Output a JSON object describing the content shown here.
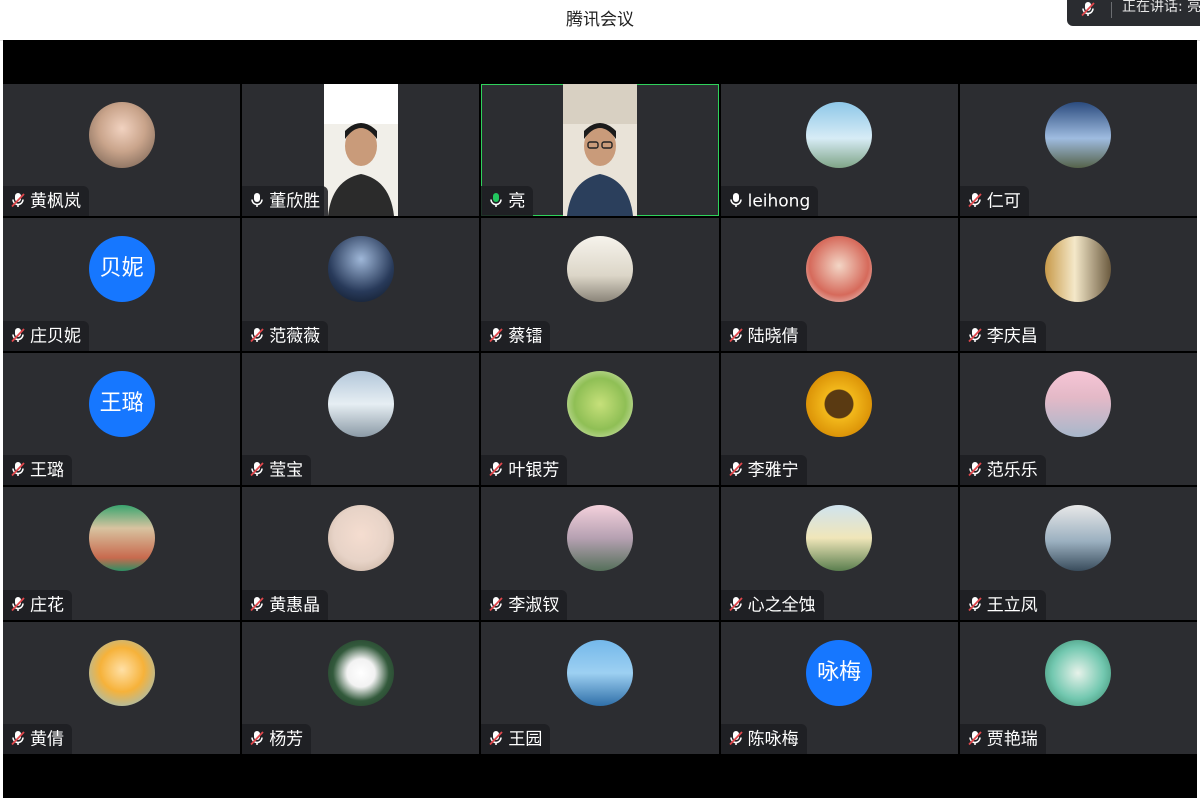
{
  "window": {
    "title": "腾讯会议"
  },
  "speaking_indicator": {
    "label": "正在讲话: 亮",
    "icon": "mic-muted-icon"
  },
  "colors": {
    "tile_bg": "#2c2d31",
    "active_border": "#2fd15b",
    "avatar_blue": "#1677ff",
    "muted_red": "#e0474c"
  },
  "participants": [
    {
      "name": "黄枫岚",
      "mic": "muted",
      "avatar": "photo"
    },
    {
      "name": "董欣胜",
      "mic": "on",
      "avatar": "video"
    },
    {
      "name": "亮",
      "mic": "speaking",
      "avatar": "video",
      "active": true
    },
    {
      "name": "leihong",
      "mic": "on",
      "avatar": "photo"
    },
    {
      "name": "仁可",
      "mic": "muted",
      "avatar": "photo"
    },
    {
      "name": "庄贝妮",
      "mic": "muted",
      "avatar": "text",
      "avatar_text": "贝妮"
    },
    {
      "name": "范薇薇",
      "mic": "muted",
      "avatar": "photo"
    },
    {
      "name": "蔡镭",
      "mic": "muted",
      "avatar": "photo"
    },
    {
      "name": "陆晓倩",
      "mic": "muted",
      "avatar": "photo"
    },
    {
      "name": "李庆昌",
      "mic": "muted",
      "avatar": "photo"
    },
    {
      "name": "王璐",
      "mic": "muted",
      "avatar": "text",
      "avatar_text": "王璐"
    },
    {
      "name": "莹宝",
      "mic": "muted",
      "avatar": "photo"
    },
    {
      "name": "叶银芳",
      "mic": "muted",
      "avatar": "photo"
    },
    {
      "name": "李雅宁",
      "mic": "muted",
      "avatar": "photo"
    },
    {
      "name": "范乐乐",
      "mic": "muted",
      "avatar": "photo"
    },
    {
      "name": "庄花",
      "mic": "muted",
      "avatar": "photo"
    },
    {
      "name": "黄惠晶",
      "mic": "muted",
      "avatar": "photo"
    },
    {
      "name": "李淑钗",
      "mic": "muted",
      "avatar": "photo"
    },
    {
      "name": "心之全蚀",
      "mic": "muted",
      "avatar": "photo"
    },
    {
      "name": "王立凤",
      "mic": "muted",
      "avatar": "photo"
    },
    {
      "name": "黄倩",
      "mic": "muted",
      "avatar": "photo"
    },
    {
      "name": "杨芳",
      "mic": "muted",
      "avatar": "photo"
    },
    {
      "name": "王园",
      "mic": "muted",
      "avatar": "photo"
    },
    {
      "name": "陈咏梅",
      "mic": "muted",
      "avatar": "text",
      "avatar_text": "咏梅"
    },
    {
      "name": "贾艳瑞",
      "mic": "muted",
      "avatar": "photo"
    }
  ]
}
